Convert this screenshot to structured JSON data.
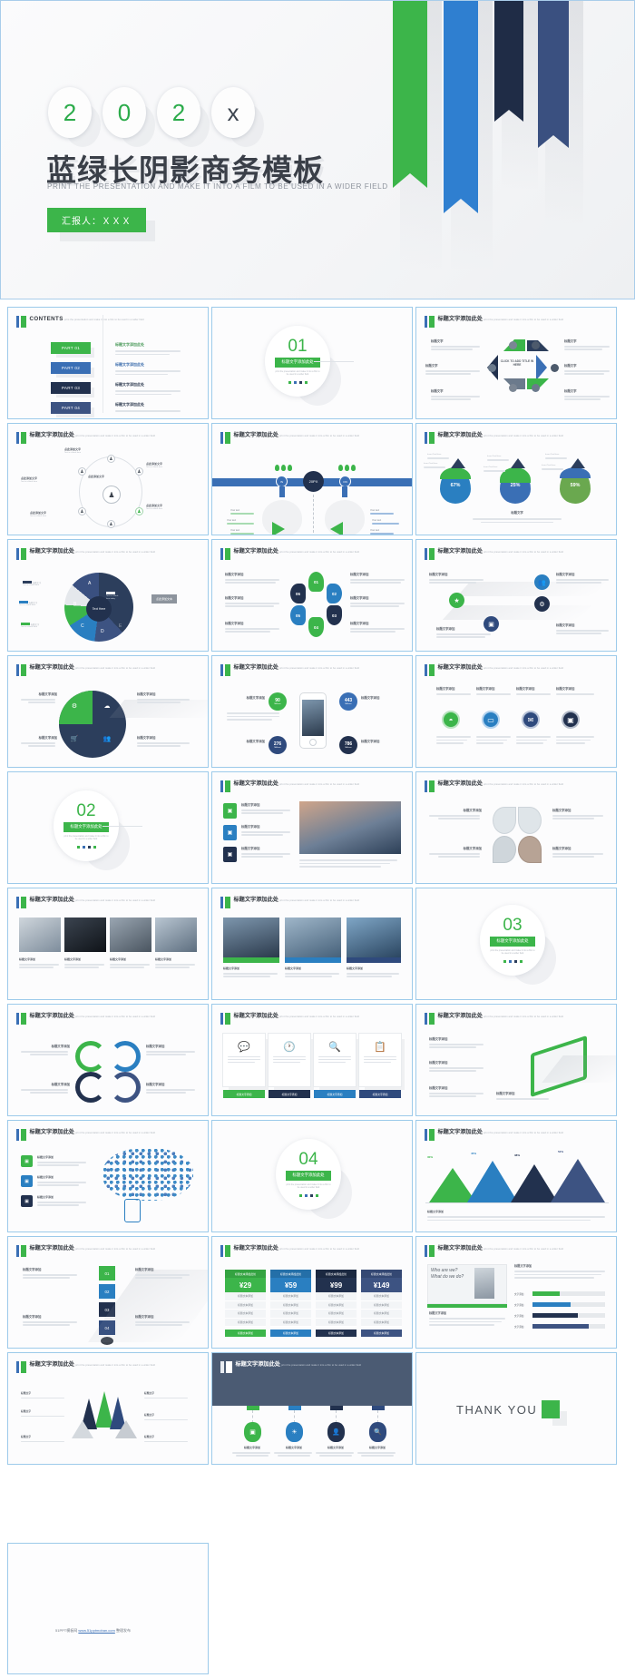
{
  "hero": {
    "year_digits": [
      "2",
      "0",
      "2",
      "x"
    ],
    "title": "蓝绿长阴影商务模板",
    "subtitle": "PRINT THE PRESENTATION AND MAKE IT INTO A FILM TO BE USED IN A WIDER FIELD",
    "presenter_badge": "汇报人：ＸＸＸ",
    "colors": {
      "green": "#3cb54a",
      "blue": "#3a6fb5",
      "navy": "#22314e",
      "steel": "#3d5382"
    }
  },
  "common": {
    "slide_title": "标题文字添加此处",
    "slide_subtitle": "print the presentation and make it into a film to be used in a wider field",
    "text_title": "标题文字添加",
    "text_title_short": "标题文字",
    "point_label": "点此添加文字",
    "your_text": "Your text",
    "add_text_en": "CLICK TO ADD TITLE IN HERE",
    "text_here": "Text Here",
    "quote_caption": "点此添加文本"
  },
  "contents": {
    "heading": "CONTENTS",
    "sub": "print the presentation and make it into a film to be used in a wider field",
    "parts": [
      {
        "chip": "PART 01",
        "color": "#3cb54a",
        "title": "标题文字添加此处"
      },
      {
        "chip": "PART 02",
        "color": "#3a6fb5",
        "title": "标题文字添加此处"
      },
      {
        "chip": "PART 03",
        "color": "#22314e",
        "title": "标题文字添加此处"
      },
      {
        "chip": "PART 04",
        "color": "#3d5382",
        "title": "标题文字添加此处"
      }
    ]
  },
  "sections": [
    {
      "num": "01",
      "chip": "标题文字添加此处",
      "body": "print the presentation and make it into a film to be used in a wider field"
    },
    {
      "num": "02",
      "chip": "标题文字添加此处",
      "body": "print the presentation and make it into a film to be used in a wider field"
    },
    {
      "num": "03",
      "chip": "标题文字添加此处",
      "body": "print the presentation and make it into a film to be used in a wider field"
    },
    {
      "num": "04",
      "chip": "标题文字添加此处",
      "body": "print the presentation and make it into a film to be used in a wider field"
    }
  ],
  "slides": {
    "hex_wheel": {
      "title": "标题文字添加此处",
      "center": "CLICK TO ADD TITLE IN HERE"
    },
    "network": {
      "title": "标题文字添加此处"
    },
    "pipes": {
      "title": "标题文字添加此处",
      "center_label": "20PX",
      "valve_left": "IN",
      "valve_right": "ON"
    },
    "droplets": {
      "title": "标题文字添加此处",
      "items": [
        {
          "value": "67%",
          "color": "#2a7fc1"
        },
        {
          "value": "25%",
          "color": "#3a6fb5"
        },
        {
          "value": "59%",
          "color": "#6aa84f"
        }
      ]
    },
    "donut": {
      "title": "标题文字添加此处",
      "labels": [
        "A",
        "B",
        "C",
        "D",
        "E"
      ],
      "center": "Text Here"
    },
    "petals": {
      "title": "标题文字添加此处",
      "numbers": [
        "01",
        "02",
        "03",
        "04",
        "05",
        "06"
      ]
    },
    "diagonal_icons": {
      "title": "标题文字添加此处",
      "icons": [
        "bulb-icon",
        "people-icon",
        "settings-icon",
        "book-icon"
      ]
    },
    "circle_icons": {
      "title": "标题文字添加此处",
      "icons": [
        "cart-icon",
        "gear-icon",
        "cloud-icon",
        "group-icon"
      ]
    },
    "phone_stats": {
      "title": "标题文字添加此处",
      "stats": [
        {
          "value": "90",
          "unit": "Millions",
          "color": "#3cb54a"
        },
        {
          "value": "443",
          "unit": "Millions",
          "color": "#3a6fb5"
        },
        {
          "value": "276",
          "unit": "Millions",
          "color": "#2f4a7d"
        },
        {
          "value": "786",
          "unit": "Millions",
          "color": "#22314e"
        }
      ]
    },
    "rings": {
      "title": "标题文字添加此处",
      "icons": [
        "wifi-icon",
        "tablet-icon",
        "mail-icon",
        "screen-icon"
      ]
    },
    "photo_list": {
      "title": "标题文字添加此处",
      "items": [
        "标题文字添加",
        "标题文字添加",
        "标题文字添加"
      ]
    },
    "clover": {
      "title": "标题文字添加此处"
    },
    "four_photos": {
      "title": "标题文字添加此处",
      "captions": [
        "标题文字添加",
        "标题文字添加",
        "标题文字添加",
        "标题文字添加"
      ]
    },
    "three_photos": {
      "title": "标题文字添加此处",
      "captions": [
        "标题文字添加",
        "标题文字添加",
        "标题文字添加"
      ]
    },
    "arrows_cycle": {
      "title": "标题文字添加此处"
    },
    "card_row": {
      "title": "标题文字添加此处",
      "cards": [
        {
          "icon": "chat-icon",
          "btn": "标题文字添加",
          "color": "#3cb54a"
        },
        {
          "icon": "clock-icon",
          "btn": "标题文字添加",
          "color": "#22314e"
        },
        {
          "icon": "search-icon",
          "btn": "标题文字添加",
          "color": "#3a6fb5"
        },
        {
          "icon": "clipboard-icon",
          "btn": "标题文字添加",
          "color": "#2f4a7d"
        }
      ]
    },
    "tablet": {
      "title": "标题文字添加此处"
    },
    "word_cloud": {
      "title": "标题文字添加此处"
    },
    "mountains": {
      "title": "标题文字添加此处"
    },
    "steps_list": {
      "title": "标题文字添加此处",
      "numbers": [
        "01",
        "02",
        "03",
        "04"
      ]
    },
    "pricing": {
      "title": "标题文字添加此处",
      "plans": [
        {
          "head": "标题文本添加此处",
          "price": "¥29",
          "sup": "/Mo",
          "color": "#3cb54a"
        },
        {
          "head": "标题文本添加此处",
          "price": "¥59",
          "sup": "/Mo",
          "color": "#2a7fc1"
        },
        {
          "head": "标题文本添加此处",
          "price": "¥99",
          "sup": "/Mo",
          "color": "#22314e"
        },
        {
          "head": "标题文本添加此处",
          "price": "¥149",
          "sup": "/Mo",
          "color": "#3d5382"
        }
      ],
      "row_label": "标题文本添加",
      "btn_label": "标题文本添加"
    },
    "bars_profile": {
      "title": "标题文字添加此处",
      "sub_title": "标题文字添加",
      "bars": [
        {
          "label": "文字添加",
          "pct": 38,
          "color": "#3cb54a"
        },
        {
          "label": "文字添加",
          "pct": 52,
          "color": "#2a7fc1"
        },
        {
          "label": "文字添加",
          "pct": 62,
          "color": "#22314e"
        },
        {
          "label": "文字添加",
          "pct": 78,
          "color": "#3d5382"
        }
      ],
      "sketch_text": "Who are we? What do we do?"
    },
    "origami": {
      "title": "标题文字添加此处"
    },
    "dark_timeline": {
      "title": "标题文字添加此处",
      "items": [
        "标题文字添加",
        "标题文字添加",
        "标题文字添加",
        "标题文字添加"
      ],
      "icons": [
        "presentation-icon",
        "bulb-icon",
        "person-icon",
        "search-icon"
      ]
    },
    "thanks": {
      "text_dark": "THANK",
      "text_light": "YOU"
    }
  },
  "footer": {
    "prefix": "51PPT模板网",
    "link": "www.51pptmoban.com",
    "suffix": "整理发布"
  }
}
